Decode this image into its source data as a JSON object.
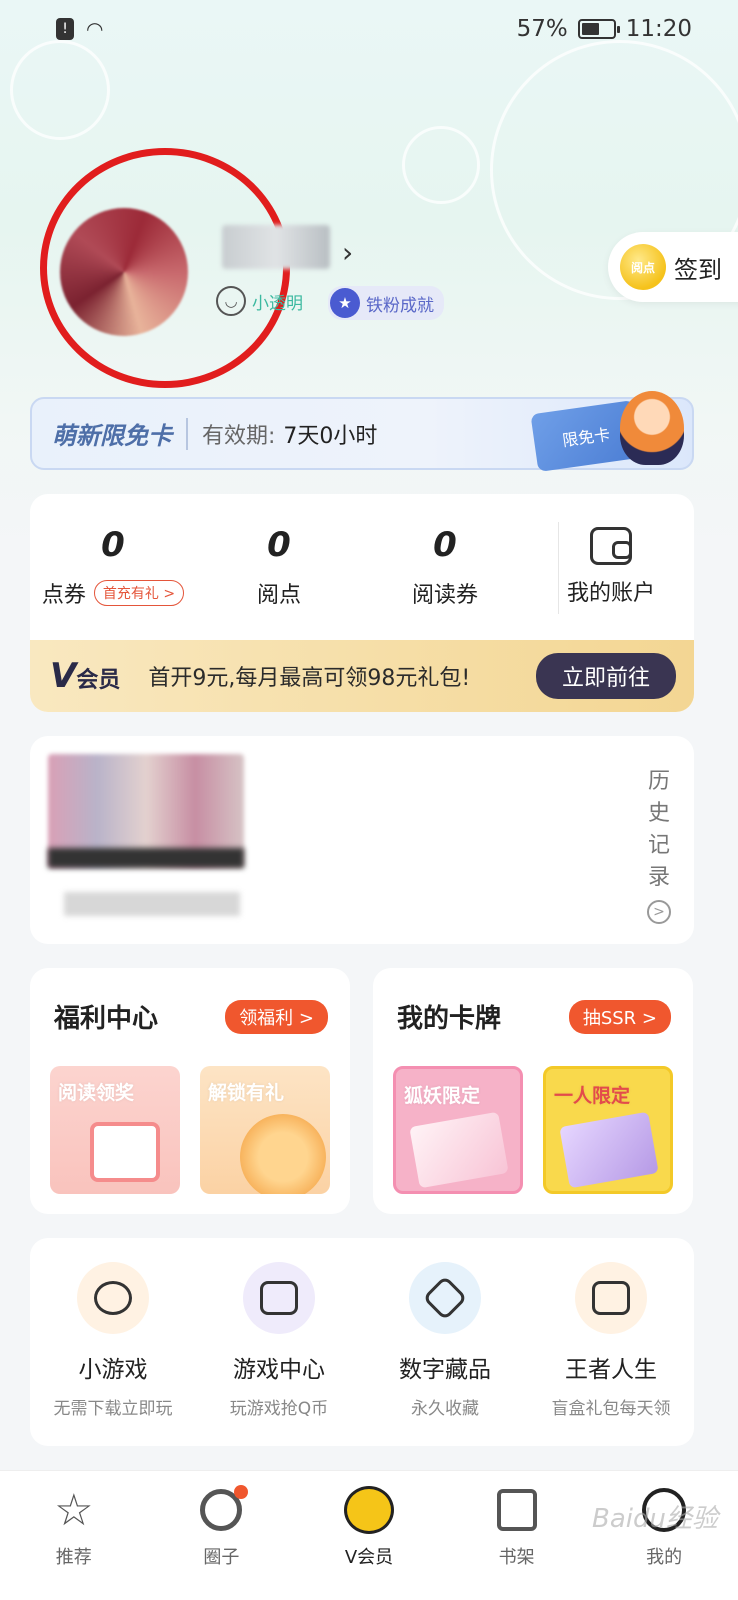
{
  "status_bar": {
    "battery": "57%",
    "time": "11:20",
    "battery_level": 0.57
  },
  "profile": {
    "tags": [
      {
        "label": "小透明",
        "icon": "smile-icon"
      },
      {
        "label": "铁粉成就",
        "icon": "star-badge-icon"
      }
    ],
    "signin_label": "签到",
    "coin_text": "阅点"
  },
  "free_card": {
    "title": "萌新限免卡",
    "validity_label": "有效期:",
    "validity_value": "7天0小时",
    "ticket_text": "限免卡"
  },
  "account": {
    "stats": [
      {
        "value": "0",
        "label": "点券",
        "badge": "首充有礼 >"
      },
      {
        "value": "0",
        "label": "阅点"
      },
      {
        "value": "0",
        "label": "阅读券"
      }
    ],
    "my_account_label": "我的账户",
    "vip": {
      "logo": "V",
      "logo_suffix": "会员",
      "text": "首开9元,每月最高可领98元礼包!",
      "button": "立即前往"
    }
  },
  "history": {
    "side_label": [
      "历",
      "史",
      "记",
      "录"
    ],
    "side_arrow": ">"
  },
  "welfare": {
    "title": "福利中心",
    "button": "领福利 >",
    "tiles": [
      "阅读领奖",
      "解锁有礼"
    ]
  },
  "cards": {
    "title": "我的卡牌",
    "button": "抽SSR >",
    "tiles": [
      "狐妖限定",
      "一人限定"
    ]
  },
  "features": [
    {
      "name": "小游戏",
      "sub": "无需下载立即玩",
      "icon": "pacman-icon"
    },
    {
      "name": "游戏中心",
      "sub": "玩游戏抢Q币",
      "icon": "gamepad-icon"
    },
    {
      "name": "数字藏品",
      "sub": "永久收藏",
      "icon": "cube-icon"
    },
    {
      "name": "王者人生",
      "sub": "盲盒礼包每天领",
      "icon": "gift-box-icon"
    }
  ],
  "tabbar": [
    {
      "label": "推荐",
      "icon": "star-icon"
    },
    {
      "label": "圈子",
      "icon": "circle-icon"
    },
    {
      "label": "V会员",
      "icon": "vip-icon"
    },
    {
      "label": "书架",
      "icon": "bookshelf-icon"
    },
    {
      "label": "我的",
      "icon": "me-icon"
    }
  ],
  "watermark": "Baidu经验"
}
